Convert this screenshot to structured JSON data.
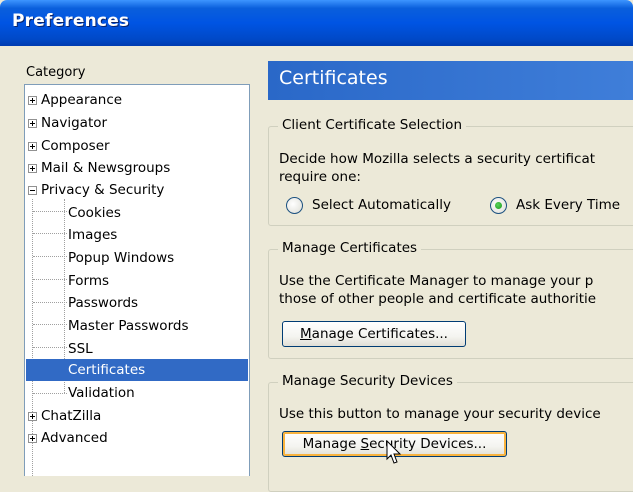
{
  "window": {
    "title": "Preferences"
  },
  "category": {
    "label": "Category",
    "items": [
      {
        "label": "Appearance",
        "expander": "plus"
      },
      {
        "label": "Navigator",
        "expander": "plus"
      },
      {
        "label": "Composer",
        "expander": "plus"
      },
      {
        "label": "Mail & Newsgroups",
        "expander": "plus"
      },
      {
        "label": "Privacy & Security",
        "expander": "minus"
      },
      {
        "label": "Cookies"
      },
      {
        "label": "Images"
      },
      {
        "label": "Popup Windows"
      },
      {
        "label": "Forms"
      },
      {
        "label": "Passwords"
      },
      {
        "label": "Master Passwords"
      },
      {
        "label": "SSL"
      },
      {
        "label": "Certificates",
        "selected": true
      },
      {
        "label": "Validation"
      },
      {
        "label": "ChatZilla",
        "expander": "plus"
      },
      {
        "label": "Advanced",
        "expander": "plus"
      }
    ]
  },
  "panel": {
    "title": "Certificates",
    "client": {
      "legend": "Client Certificate Selection",
      "line1": "Decide how Mozilla selects a security certificat",
      "line2": "require one:",
      "option1": "Select Automatically",
      "option2": "Ask Every Time",
      "selected": "option2"
    },
    "manage": {
      "legend": "Manage Certificates",
      "line1": "Use the Certificate Manager to manage your p",
      "line2": "those of other people and certificate authoritie",
      "button_underlined": "M",
      "button_rest": "anage Certificates..."
    },
    "devices": {
      "legend": "Manage Security Devices",
      "line1": "Use this button to manage your security device",
      "button_pre": "Manage ",
      "button_underlined": "S",
      "button_post": "ecurity Devices..."
    }
  },
  "colors": {
    "accent": "#316ac5",
    "header": "#2a68c8",
    "titlebar": "#0054e3",
    "dialog_bg": "#ece9d8"
  }
}
